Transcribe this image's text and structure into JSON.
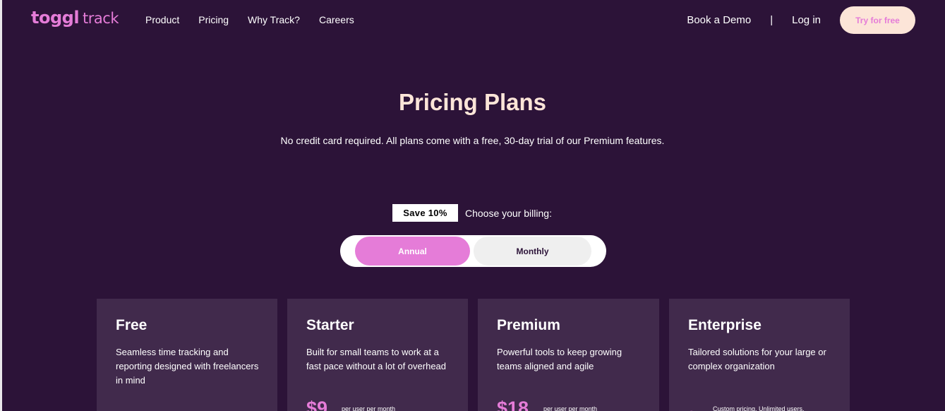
{
  "nav": {
    "logo_primary": "toggl",
    "logo_secondary": "track",
    "links": [
      "Product",
      "Pricing",
      "Why Track?",
      "Careers"
    ],
    "book_demo": "Book a Demo",
    "separator": "|",
    "login": "Log in",
    "try_free": "Try for free"
  },
  "hero": {
    "title": "Pricing Plans",
    "subtitle": "No credit card required. All plans come with a free, 30-day trial of our Premium features."
  },
  "billing": {
    "badge": "Save 10%",
    "label": "Choose your billing:",
    "options": [
      "Annual",
      "Monthly"
    ],
    "selected": "Annual"
  },
  "plans": [
    {
      "name": "Free",
      "description": "Seamless time tracking and reporting designed with freelancers in mind",
      "price": "",
      "price_note": ""
    },
    {
      "name": "Starter",
      "description": "Built for small teams to work at a fast pace without a lot of overhead",
      "price": "$9",
      "price_note": "per user per month"
    },
    {
      "name": "Premium",
      "description": "Powerful tools to keep growing teams aligned and agile",
      "price": "$18",
      "price_note": "per user per month"
    },
    {
      "name": "Enterprise",
      "description": "Tailored solutions for your large or complex organization",
      "price": "~",
      "price_note": "Custom pricing. Unlimited users."
    }
  ],
  "colors": {
    "background": "#2c1338",
    "card": "#412a4c",
    "accent": "#e57cd8",
    "cream": "#fce5d8"
  }
}
